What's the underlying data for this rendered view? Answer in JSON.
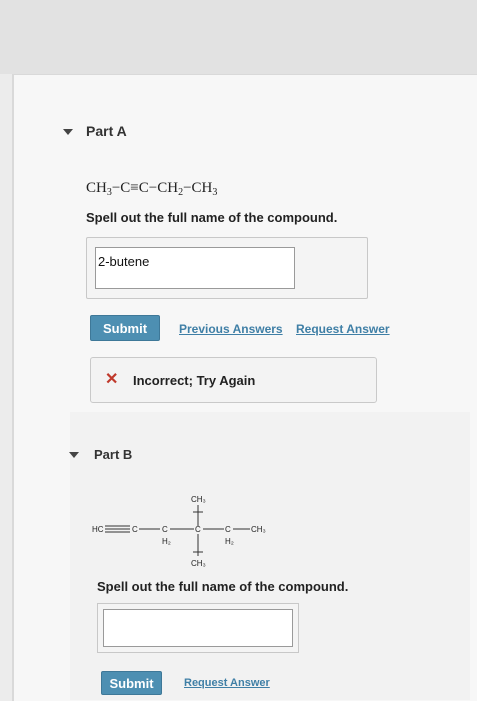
{
  "part_a": {
    "title": "Part A",
    "formula": {
      "ch3_a": "CH",
      "sub3_a": "3",
      "middle": "−C≡C−CH",
      "sub2": "2",
      "dash": "−CH",
      "sub3_b": "3"
    },
    "prompt": "Spell out the full name of the compound.",
    "answer_value": "2-butene",
    "submit_label": "Submit",
    "previous_answers_label": "Previous Answers",
    "request_answer_label": "Request Answer",
    "feedback_icon": "x-icon",
    "feedback_text": "Incorrect; Try Again"
  },
  "part_b": {
    "title": "Part B",
    "structure_labels": {
      "ch3_top": "CH₃",
      "hc": "HC",
      "c1": "C",
      "c2": "C",
      "h2_a": "H₂",
      "c3": "C",
      "c4": "C",
      "h2_b": "H₂",
      "ch3_right": "CH₃",
      "ch3_bottom": "CH₃"
    },
    "prompt": "Spell out the full name of the compound.",
    "answer_value": "",
    "submit_label": "Submit",
    "request_answer_label": "Request Answer"
  },
  "colors": {
    "submit_bg": "#4d8fb2",
    "link": "#3f7fa6",
    "error": "#c0392b"
  }
}
